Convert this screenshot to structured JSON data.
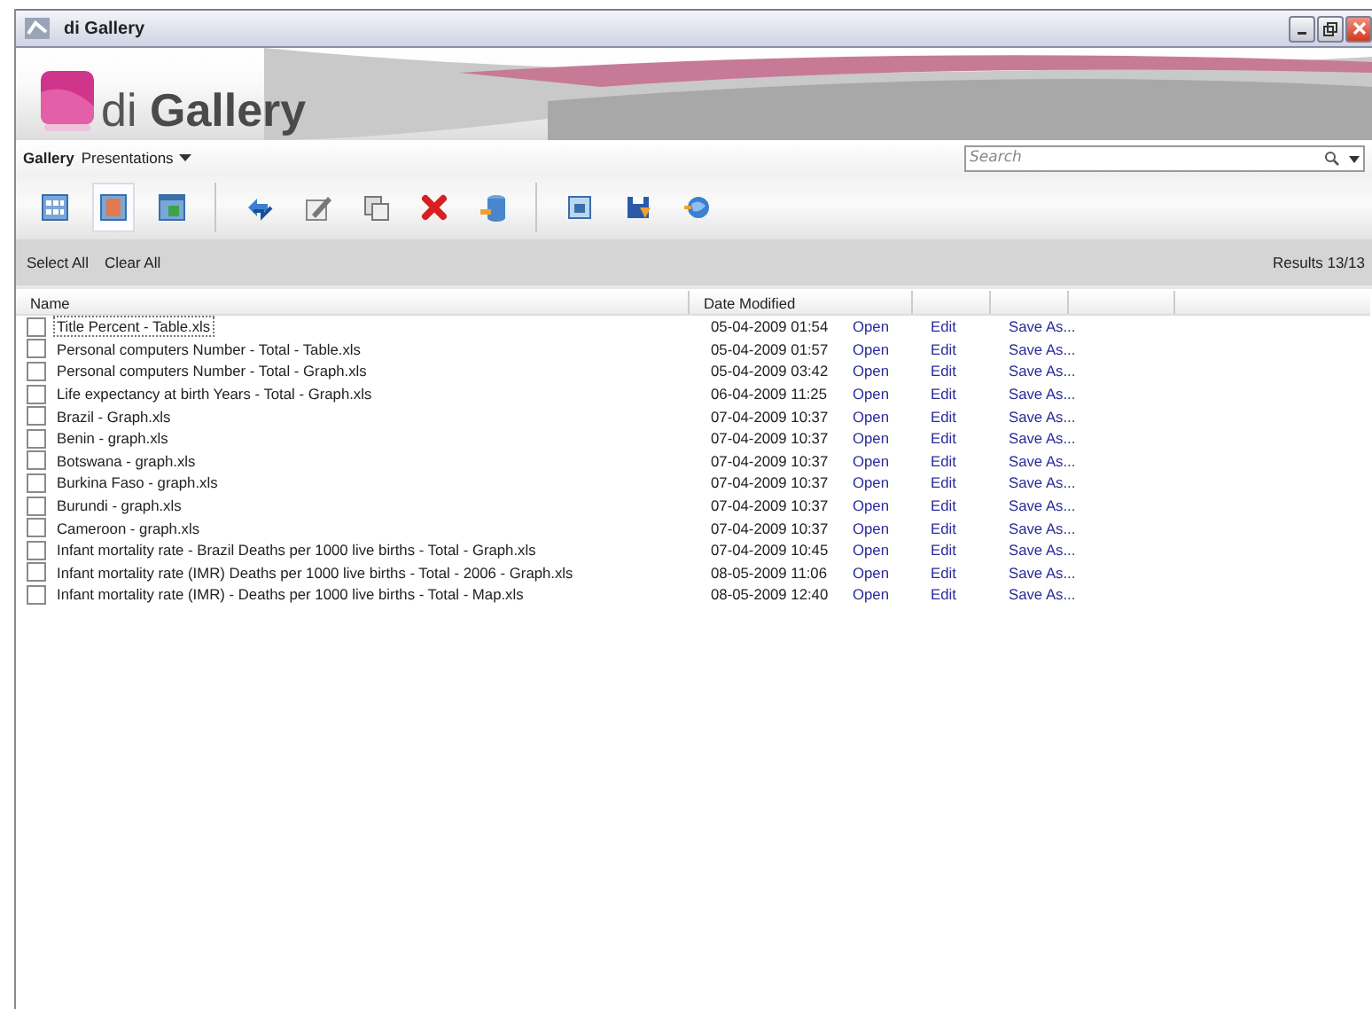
{
  "window": {
    "title": "di Gallery"
  },
  "banner": {
    "title": "di **Gallery**"
  },
  "menu": [
    {
      "label": "Gallery",
      "kind": "current"
    },
    {
      "label": "Presentations",
      "kind": "dropdown"
    }
  ],
  "search": {
    "placeholder": "Search"
  },
  "toolbar": {
    "views": [
      {
        "selected": false
      },
      {
        "selected": true
      },
      {
        "selected": false
      }
    ]
  },
  "selection_bar": {
    "select_all": "Select All",
    "clear_all": "Clear All",
    "results": "Results 13/13"
  },
  "table": {
    "columns": [
      "Name",
      "Date Modified"
    ],
    "rows": [
      {
        "checked": false,
        "focused": true,
        "name": "Title Percent - Table.xls",
        "date": "05-04-2009 01:54",
        "actions": [
          "Open",
          "Edit",
          "Save As..."
        ]
      },
      {
        "checked": false,
        "focused": false,
        "name": "Personal computers Number - Total - Table.xls",
        "date": "05-04-2009 01:57",
        "actions": [
          "Open",
          "Edit",
          "Save As..."
        ]
      },
      {
        "checked": false,
        "focused": false,
        "name": "Personal computers Number - Total - Graph.xls",
        "date": "05-04-2009 03:42",
        "actions": [
          "Open",
          "Edit",
          "Save As..."
        ]
      },
      {
        "checked": false,
        "focused": false,
        "name": "Life expectancy at birth Years - Total - Graph.xls",
        "date": "06-04-2009 11:25",
        "actions": [
          "Open",
          "Edit",
          "Save As..."
        ]
      },
      {
        "checked": false,
        "focused": false,
        "name": "Brazil - Graph.xls",
        "date": "07-04-2009 10:37",
        "actions": [
          "Open",
          "Edit",
          "Save As..."
        ]
      },
      {
        "checked": false,
        "focused": false,
        "name": "Benin - graph.xls",
        "date": "07-04-2009 10:37",
        "actions": [
          "Open",
          "Edit",
          "Save As..."
        ]
      },
      {
        "checked": false,
        "focused": false,
        "name": "Botswana - graph.xls",
        "date": "07-04-2009 10:37",
        "actions": [
          "Open",
          "Edit",
          "Save As..."
        ]
      },
      {
        "checked": false,
        "focused": false,
        "name": "Burkina Faso - graph.xls",
        "date": "07-04-2009 10:37",
        "actions": [
          "Open",
          "Edit",
          "Save As..."
        ]
      },
      {
        "checked": false,
        "focused": false,
        "name": "Burundi - graph.xls",
        "date": "07-04-2009 10:37",
        "actions": [
          "Open",
          "Edit",
          "Save As..."
        ]
      },
      {
        "checked": false,
        "focused": false,
        "name": "Cameroon - graph.xls",
        "date": "07-04-2009 10:37",
        "actions": [
          "Open",
          "Edit",
          "Save As..."
        ]
      },
      {
        "checked": false,
        "focused": false,
        "name": "Infant mortality rate - Brazil Deaths per 1000 live births - Total - Graph.xls",
        "date": "07-04-2009 10:45",
        "actions": [
          "Open",
          "Edit",
          "Save As..."
        ]
      },
      {
        "checked": false,
        "focused": false,
        "name": "Infant mortality rate (IMR) Deaths per 1000 live births - Total - 2006 - Graph.xls",
        "date": "08-05-2009 11:06",
        "actions": [
          "Open",
          "Edit",
          "Save As..."
        ]
      },
      {
        "checked": false,
        "focused": false,
        "name": "Infant mortality rate (IMR) - Deaths per 1000 live births - Total - Map.xls",
        "date": "08-05-2009 12:40",
        "actions": [
          "Open",
          "Edit",
          "Save As..."
        ]
      }
    ]
  }
}
